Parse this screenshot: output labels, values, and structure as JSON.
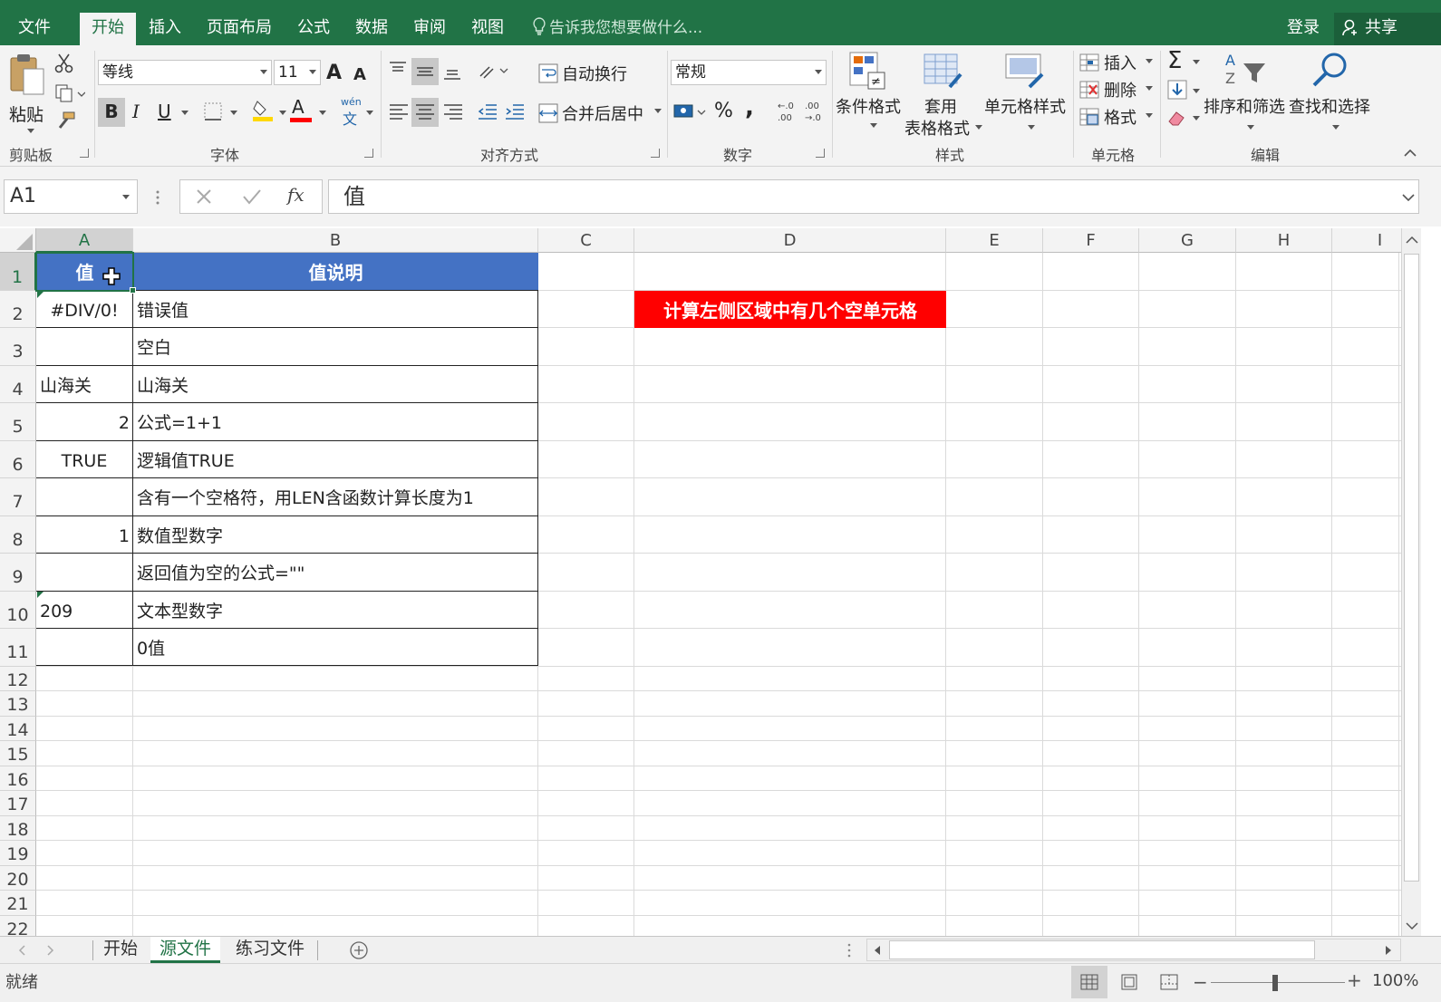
{
  "tabs": [
    "文件",
    "开始",
    "插入",
    "页面布局",
    "公式",
    "数据",
    "审阅",
    "视图"
  ],
  "active_tab": "开始",
  "tell_me": "告诉我您想要做什么...",
  "login": "登录",
  "share": "共享",
  "ribbon": {
    "clipboard": {
      "paste": "粘贴",
      "label": "剪贴板"
    },
    "font": {
      "name": "等线",
      "size": "11",
      "label": "字体",
      "grow": "A",
      "shrink": "A",
      "bold": "B",
      "italic": "I",
      "underline": "U",
      "font_color": "A",
      "wen": "wén",
      "wen_char": "文"
    },
    "align": {
      "wrap": "自动换行",
      "merge": "合并后居中",
      "label": "对齐方式"
    },
    "number": {
      "format": "常规",
      "label": "数字",
      "percent": "%",
      "comma": ","
    },
    "styles": {
      "cond": "条件格式",
      "table1": "套用",
      "table2": "表格格式",
      "cell": "单元格样式",
      "label": "样式"
    },
    "cells": {
      "insert": "插入",
      "delete": "删除",
      "format": "格式",
      "label": "单元格"
    },
    "editing": {
      "sort": "排序和筛选",
      "find": "查找和选择",
      "label": "编辑",
      "sigma": "Σ"
    }
  },
  "formula_bar": {
    "name_box": "A1",
    "fx": "fx",
    "content": "值"
  },
  "columns": [
    "A",
    "B",
    "C",
    "D",
    "E",
    "F",
    "G",
    "H",
    "I"
  ],
  "rows": [
    "1",
    "2",
    "3",
    "4",
    "5",
    "6",
    "7",
    "8",
    "9",
    "10",
    "11",
    "12",
    "13",
    "14",
    "15",
    "16",
    "17",
    "18",
    "19",
    "20",
    "21",
    "22"
  ],
  "table": {
    "headers": [
      "值",
      "值说明"
    ],
    "rows": [
      [
        "#DIV/0!",
        "错误值"
      ],
      [
        "",
        "空白"
      ],
      [
        "山海关",
        "山海关"
      ],
      [
        "2",
        "公式=1+1"
      ],
      [
        "TRUE",
        "逻辑值TRUE"
      ],
      [
        "",
        "含有一个空格符，用LEN含函数计算长度为1"
      ],
      [
        "1",
        "数值型数字"
      ],
      [
        "",
        "返回值为空的公式=\"\""
      ],
      [
        "209",
        "文本型数字"
      ],
      [
        "",
        "0值"
      ]
    ]
  },
  "note": "计算左侧区域中有几个空单元格",
  "colors": {
    "header_fill": "#4472c4",
    "note_fill": "#ff0000",
    "accent": "#217346"
  },
  "sheets": [
    "开始",
    "源文件",
    "练习文件"
  ],
  "active_sheet": "源文件",
  "status": "就绪",
  "zoom": "100%"
}
